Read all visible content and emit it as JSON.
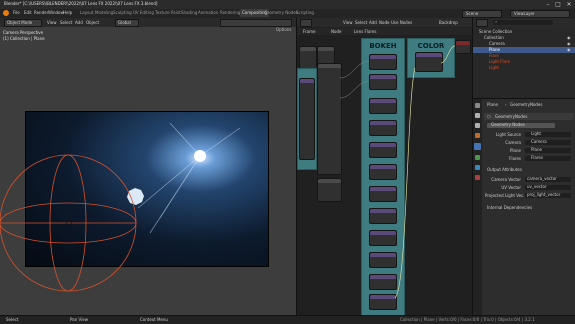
{
  "title": "Blender* [C:\\\\USERS\\\\BLENDER\\\\2022\\\\07 Lens FX 2022\\\\07 Lens FX 3.blend]",
  "window_controls": [
    "–",
    "□",
    "✕"
  ],
  "menu": [
    "File",
    "Edit",
    "Render",
    "Window",
    "Help"
  ],
  "workspaces": [
    "Layout",
    "Modeling",
    "Sculpting",
    "UV Editing",
    "Texture Paint",
    "Shading",
    "Animation",
    "Rendering",
    "Compositing",
    "Geometry Nodes",
    "Scripting"
  ],
  "scene": {
    "label": "Scene",
    "layer": "ViewLayer"
  },
  "viewport": {
    "mode": "Object Mode",
    "menus": [
      "View",
      "Select",
      "Add",
      "Object"
    ],
    "transform": "Global",
    "overlay_title": "Camera Perspective",
    "overlay_subtitle": "(1) Collection | Plane",
    "options": "Options"
  },
  "node_editor": {
    "menus": [
      "View",
      "Select",
      "Add",
      "Node"
    ],
    "toggle": "Use Nodes",
    "backdrop": "Backdrop",
    "tool_tabs": [
      "Frame",
      "Node",
      "Lens Flares"
    ],
    "frames": [
      "BOKEH",
      "COLOR"
    ]
  },
  "outliner": {
    "search_placeholder": "",
    "items": [
      "Scene Collection",
      "Collection",
      "Camera",
      "Plane",
      "Flare",
      "Light Flare",
      "Light"
    ]
  },
  "properties": {
    "breadcrumb_a": "Plane",
    "breadcrumb_b": "GeometryNodes",
    "section_title": "GeometryNodes",
    "node_group": "Geometry Nodes",
    "rows": [
      {
        "label": "Light Source",
        "value": "Light"
      },
      {
        "label": "Camera",
        "value": "Camera"
      },
      {
        "label": "Plane",
        "value": "Plane"
      },
      {
        "label": "Flares",
        "value": "Flares"
      }
    ],
    "output_section": "Output Attributes",
    "output_rows": [
      {
        "label": "Camera Vector",
        "value": "camera_vector"
      },
      {
        "label": "UV Vector",
        "value": "uv_vector"
      },
      {
        "label": "Projected Light Vec.",
        "value": "proj_light_vector"
      }
    ],
    "internal_section": "Internal Dependencies"
  },
  "status": {
    "left": "Select",
    "middle": "Pan View",
    "right": "Context Menu",
    "version": "Collection | Plane | Verts:0/0 | Faces:0/0 | Tris:0 | Objects:0/4 | 3.2.1"
  },
  "colors": {
    "frame": "#3e7c82",
    "camera_rig": "#d6522a",
    "selected_item": "#3d5a8a",
    "accent": "#4772b3"
  },
  "icons": [
    "blender-logo-icon",
    "camera-icon",
    "light-icon",
    "mesh-icon",
    "eye-icon",
    "wrench-icon",
    "node-tree-icon",
    "search-icon"
  ]
}
